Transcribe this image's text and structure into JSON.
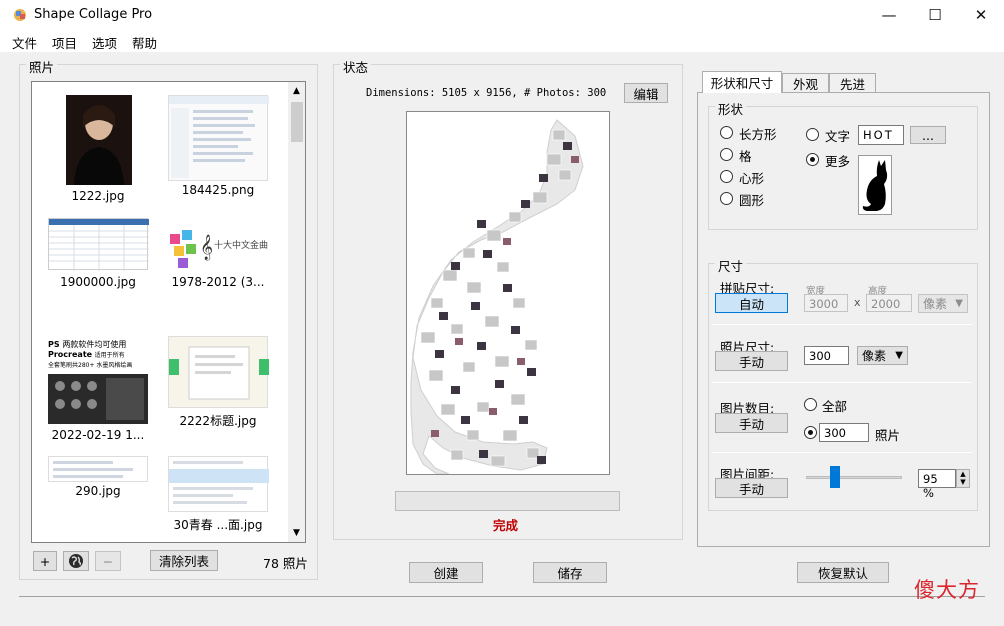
{
  "window": {
    "title": "Shape Collage Pro",
    "minimize": "—",
    "maximize": "☐",
    "close": "✕"
  },
  "menu": [
    "文件",
    "项目",
    "选项",
    "帮助"
  ],
  "photos_panel": {
    "label": "照片",
    "items": [
      {
        "caption": "1222.jpg"
      },
      {
        "caption": "184425.png"
      },
      {
        "caption": "1900000.jpg"
      },
      {
        "caption": "1978-2012 (3..."
      },
      {
        "caption": "2022-02-19 1..."
      },
      {
        "caption": "2222标题.jpg"
      },
      {
        "caption": "290.jpg"
      },
      {
        "caption": "30青春 ...面.jpg"
      }
    ],
    "thumb_texts": {
      "ps_line1": "PS",
      "ps_line1b": "两款软件均可使用",
      "ps_line2": "Procreate",
      "ps_line2b": "适用于所有",
      "ps_line3": "全套笔刷共280+",
      "ps_line3b": "水墨风格绘画",
      "banner_title": "十大中文金曲"
    },
    "add_button": "+",
    "remove_button": "−",
    "clear_button": "清除列表",
    "count": "78",
    "count_unit": "照片"
  },
  "status_panel": {
    "label": "状态",
    "dimensions": "Dimensions: 5105 x 9156, # Photos: 300",
    "edit_button": "编辑",
    "status_text": "完成",
    "progress": 0
  },
  "bottom_buttons": {
    "create": "创建",
    "save": "储存",
    "reset": "恢复默认"
  },
  "tabs": [
    {
      "label": "形状和尺寸",
      "active": true
    },
    {
      "label": "外观",
      "active": false
    },
    {
      "label": "先进",
      "active": false
    }
  ],
  "shape_group": {
    "label": "形状",
    "options_left": [
      "长方形",
      "格",
      "心形",
      "圆形"
    ],
    "text_option": "文字",
    "text_value": "HOT",
    "more_option": "更多",
    "browse_button": "...",
    "selected": "更多"
  },
  "size_group": {
    "label": "尺寸",
    "collage_size_label": "拼贴尺寸:",
    "collage_mode_button": "自动",
    "width_label": "宽度",
    "height_label": "高度",
    "width_value": "3000",
    "times": "x",
    "height_value": "2000",
    "collage_unit": "像素",
    "photo_size_label": "照片尺寸:",
    "photo_mode_button": "手动",
    "photo_size_value": "300",
    "photo_unit": "像素",
    "photo_count_label": "图片数目:",
    "photo_count_mode_button": "手动",
    "count_all_label": "全部",
    "count_value": "300",
    "count_unit": "照片",
    "spacing_label": "图片间距:",
    "spacing_mode_button": "手动",
    "spacing_value": "95 %",
    "spacing_level": 0.28
  },
  "watermark": "傻大方",
  "colors": {
    "accent_blue": "#0078d7",
    "status_red": "#c00000",
    "slider_blue": "#0078d7"
  }
}
